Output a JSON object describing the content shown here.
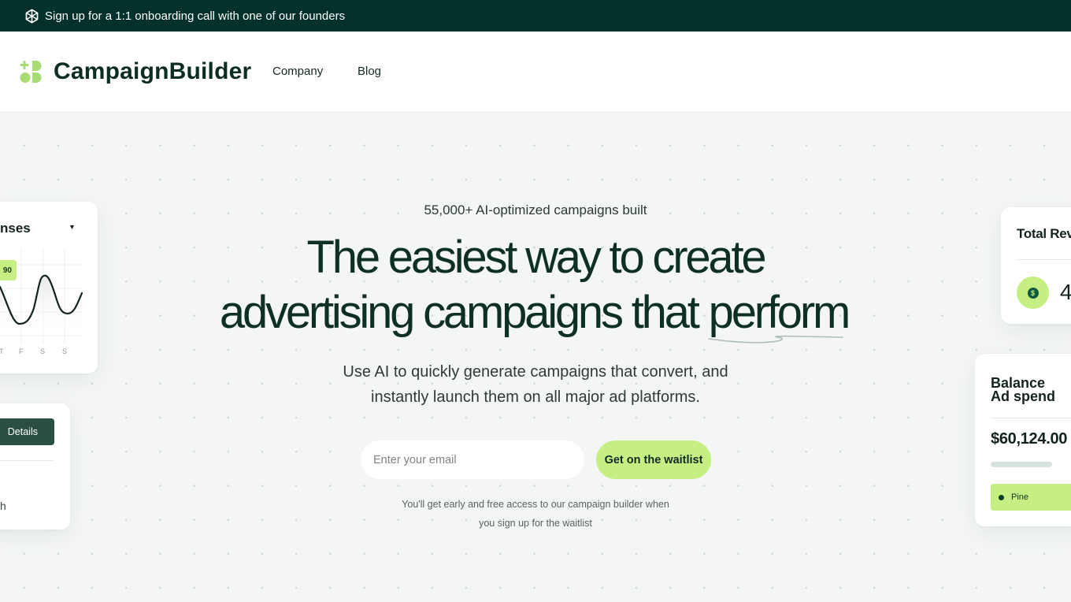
{
  "announcement": {
    "icon": "snowflake-hex-icon",
    "text": "Sign up for a 1:1 onboarding call with one of our founders"
  },
  "nav": {
    "brand": "CampaignBuilder",
    "logo_icon": "plus-blocks-logo-icon",
    "links": [
      {
        "label": "Company"
      },
      {
        "label": "Blog"
      }
    ]
  },
  "hero": {
    "eyebrow": "55,000+ AI-optimized campaigns built",
    "headline_line1": "The easiest way to create",
    "headline_line2": "advertising campaigns that",
    "headline_highlight": "perform",
    "subheading_line1": "Use AI to quickly generate campaigns that convert, and",
    "subheading_line2": "instantly launch them on all major ad platforms.",
    "email_placeholder": "Enter your email",
    "email_value": "",
    "cta_label": "Get on the waitlist",
    "note_line1": "You'll get early and free access to our campaign builder when",
    "note_line2": "you sign up for the waitlist"
  },
  "cards": {
    "expenses": {
      "title_fragment": "nses",
      "dropdown_icon": "caret-down-icon",
      "tooltip_value": "90",
      "x_labels": [
        "T",
        "F",
        "S",
        "S"
      ]
    },
    "details": {
      "button_label": "Details",
      "text_fragment": "h"
    },
    "revenue": {
      "title_fragment": "Total Rev",
      "icon": "dollar-coin-icon",
      "value_fragment": "4"
    },
    "balance": {
      "title_line1": "Balance",
      "title_line2": "Ad spend",
      "amount_fragment": "$60,124.00",
      "chip_label": "Pine"
    }
  },
  "colors": {
    "brand_dark": "#02302a",
    "accent_lime": "#c5ef83",
    "text_dark": "#0e2f24",
    "background": "#f3f6f5"
  }
}
